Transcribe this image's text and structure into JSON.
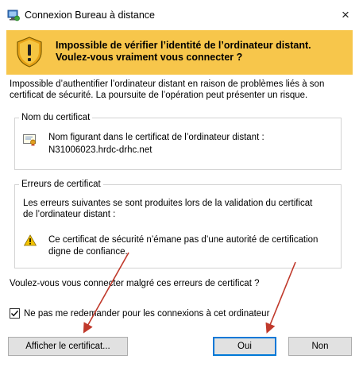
{
  "window": {
    "title": "Connexion Bureau à distance",
    "close_symbol": "×"
  },
  "banner": {
    "line1": "Impossible de vérifier l’identité de l’ordinateur distant.",
    "line2": "Voulez-vous vraiment vous connecter ?"
  },
  "intro": {
    "line1": "Impossible d’authentifier l’ordinateur distant en raison de problèmes liés à son",
    "line2": "certificat de sécurité. La poursuite de l’opération peut présenter un risque."
  },
  "certificate_group": {
    "title": "Nom du certificat",
    "label": "Nom figurant dans le certificat de l’ordinateur distant :",
    "value": "N31006023.hrdc-drhc.net",
    "icon": "certificate-icon"
  },
  "errors_group": {
    "title": "Erreurs de certificat",
    "intro_line1": "Les erreurs suivantes se sont produites lors de la validation du certificat",
    "intro_line2": "de l’ordinateur distant :",
    "errors": [
      {
        "line1": "Ce certificat de sécurité n’émane pas d’une autorité de certification",
        "line2": "digne de confiance.",
        "icon": "warning-icon"
      }
    ]
  },
  "question": "Voulez-vous vous connecter malgré ces erreurs de certificat ?",
  "dont_ask": {
    "label": "Ne pas me redemander pour les connexions à cet ordinateur",
    "checked": true
  },
  "buttons": {
    "view_certificate": "Afficher le certificat...",
    "yes": "Oui",
    "no": "Non"
  },
  "colors": {
    "banner": "#f7c64b",
    "annotation_arrow": "#c0392b",
    "default_button_border": "#0078d7"
  }
}
